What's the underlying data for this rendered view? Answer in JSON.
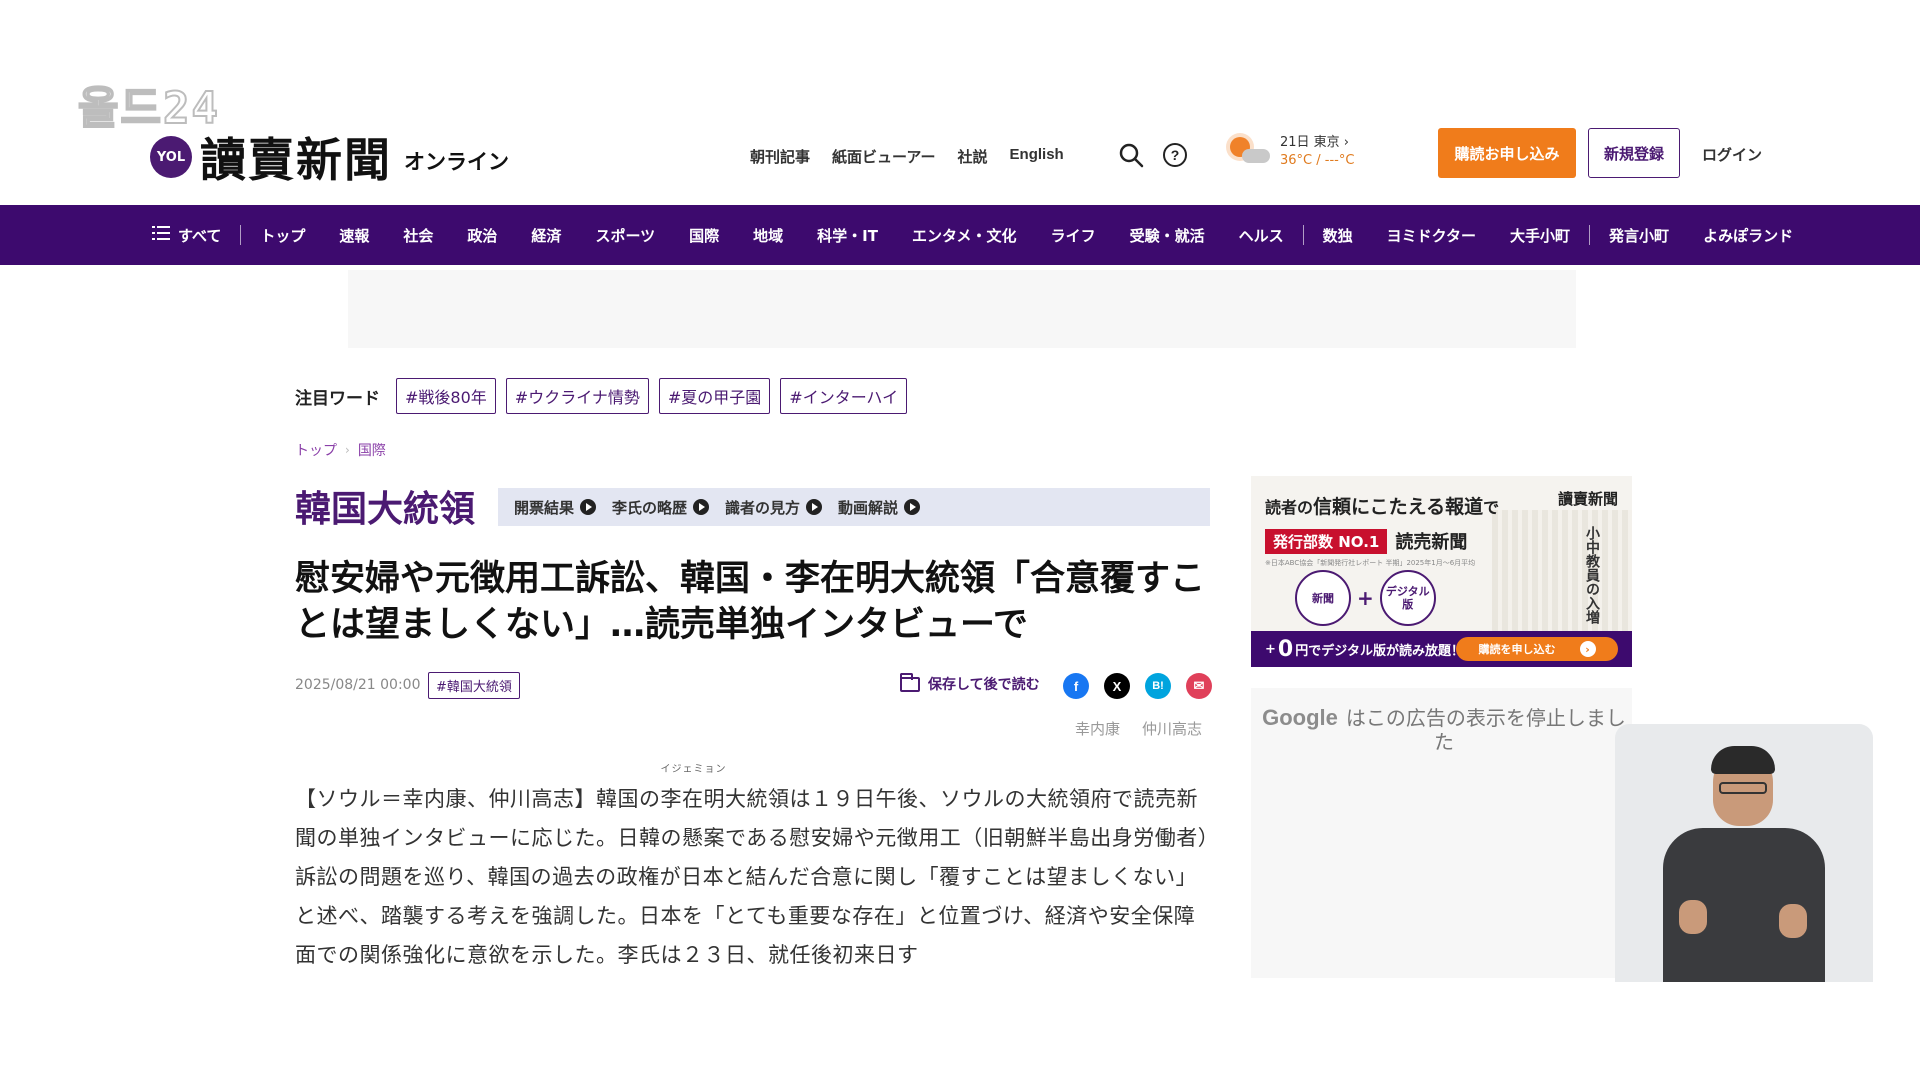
{
  "watermark": "올드24",
  "header": {
    "logo_badge": "YOL",
    "logo_main": "讀賣新聞",
    "logo_sub": "オンライン",
    "links": [
      "朝刊記事",
      "紙面ビューアー",
      "社説",
      "English"
    ],
    "weather": {
      "date_city": "21日 東京 ›",
      "temp": "36°C / ---°C"
    },
    "subscribe_label": "購読お申し込み",
    "register_label": "新規登録",
    "login_label": "ログイン"
  },
  "nav": {
    "all_label": "すべて",
    "items_a": [
      "トップ",
      "速報",
      "社会",
      "政治",
      "経済",
      "スポーツ",
      "国際",
      "地域",
      "科学・IT",
      "エンタメ・文化",
      "ライフ",
      "受験・就活",
      "ヘルス"
    ],
    "items_b": [
      "数独",
      "ヨミドクター",
      "大手小町"
    ],
    "items_c": [
      "発言小町",
      "よみぽランド"
    ]
  },
  "trending": {
    "label": "注目ワード",
    "tags": [
      "#戦後80年",
      "#ウクライナ情勢",
      "#夏の甲子園",
      "#インターハイ"
    ]
  },
  "breadcrumb": [
    "トップ",
    "国際"
  ],
  "topic": {
    "title": "韓国大統領",
    "links": [
      "開票結果",
      "李氏の略歴",
      "識者の見方",
      "動画解説"
    ]
  },
  "article": {
    "headline": "慰安婦や元徴用工訴訟、韓国・李在明大統領「合意覆すことは望ましくない」…読売単独インタビューで",
    "date": "2025/08/21 00:00",
    "tag": "#韓国大統領",
    "save_label": "保存して後で読む",
    "share": {
      "facebook": "f",
      "x": "X",
      "hatena": "B!",
      "mail": "✉"
    },
    "authors": [
      "幸内康",
      "仲川高志"
    ],
    "body_pre": "【ソウル＝幸内康、仲川高志】韓国の",
    "body_ruby_base": "李在明",
    "body_ruby_text": "イジェミョン",
    "body_post": "大統領は１９日午後、ソウルの大統領府で読売新聞の単独インタビューに応じた。日韓の懸案である慰安婦や元徴用工（旧朝鮮半島出身労働者）訴訟の問題を巡り、韓国の過去の政権が日本と結んだ合意に関し「覆すことは望ましくない」と述べ、踏襲する考えを強調した。日本を「とても重要な存在」と位置づけ、経済や安全保障面での関係強化に意欲を示した。李氏は２３日、就任後初来日す"
  },
  "sidebar_ad": {
    "headline_pre": "読者の",
    "headline_big": "信頼にこたえる報道",
    "headline_post": "で",
    "brand": "讀賣新聞",
    "badge": "発行部数 NO.1",
    "name": "読売新聞",
    "note": "※日本ABC協会「新聞発行社レポート 半期」2025年1月〜6月平均",
    "circle1": "新聞",
    "circle2": "デジタル版",
    "paper_head": "小中教員の入増",
    "bottom_pre": "+",
    "bottom_zero": "0",
    "bottom_post": "円でデジタル版が読み放題！",
    "cta": "購読を申し込む"
  },
  "google_ad": {
    "google": "Google",
    "message": "はこの広告の表示を停止しました"
  },
  "colors": {
    "brand_purple": "#3d0a6e",
    "accent_orange": "#f07c1b",
    "facebook": "#1877f2",
    "x": "#000000",
    "hatena": "#00a4de",
    "mail": "#e0405a"
  }
}
